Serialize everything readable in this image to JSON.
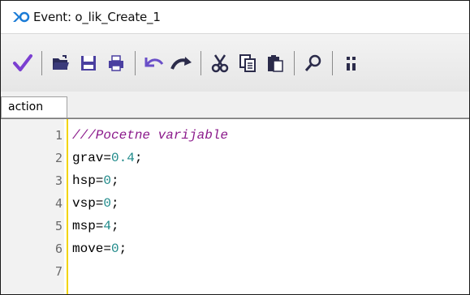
{
  "window": {
    "title": "Event: o_lik_Create_1",
    "logo_icon": "gamemaker-logo-icon"
  },
  "toolbar": {
    "buttons": [
      {
        "name": "ok-checkmark-icon"
      },
      {
        "name": "open-folder-icon"
      },
      {
        "name": "save-icon"
      },
      {
        "name": "print-icon"
      },
      {
        "name": "undo-icon"
      },
      {
        "name": "redo-icon"
      },
      {
        "name": "cut-icon"
      },
      {
        "name": "copy-icon"
      },
      {
        "name": "paste-icon"
      },
      {
        "name": "search-icon"
      },
      {
        "name": "goto-line-icon"
      }
    ]
  },
  "tabs": [
    {
      "label": "action"
    }
  ],
  "editor": {
    "lines": [
      {
        "n": "1",
        "parts": [
          {
            "t": "///Pocetne varijable",
            "c": "comment"
          }
        ]
      },
      {
        "n": "2",
        "parts": [
          {
            "t": "grav=",
            "c": "plain"
          },
          {
            "t": "0.4",
            "c": "num"
          },
          {
            "t": ";",
            "c": "plain"
          }
        ]
      },
      {
        "n": "3",
        "parts": [
          {
            "t": "hsp=",
            "c": "plain"
          },
          {
            "t": "0",
            "c": "num"
          },
          {
            "t": ";",
            "c": "plain"
          }
        ]
      },
      {
        "n": "4",
        "parts": [
          {
            "t": "vsp=",
            "c": "plain"
          },
          {
            "t": "0",
            "c": "num"
          },
          {
            "t": ";",
            "c": "plain"
          }
        ]
      },
      {
        "n": "5",
        "parts": [
          {
            "t": "msp=",
            "c": "plain"
          },
          {
            "t": "4",
            "c": "num"
          },
          {
            "t": ";",
            "c": "plain"
          }
        ]
      },
      {
        "n": "6",
        "parts": [
          {
            "t": "move=",
            "c": "plain"
          },
          {
            "t": "0",
            "c": "num"
          },
          {
            "t": ";",
            "c": "plain"
          }
        ]
      },
      {
        "n": "7",
        "parts": []
      }
    ]
  },
  "colors": {
    "comment": "#8b1a8b",
    "number": "#1f8a8a",
    "gutter_line": "#f2d400",
    "checkmark": "#7b3fd1"
  }
}
